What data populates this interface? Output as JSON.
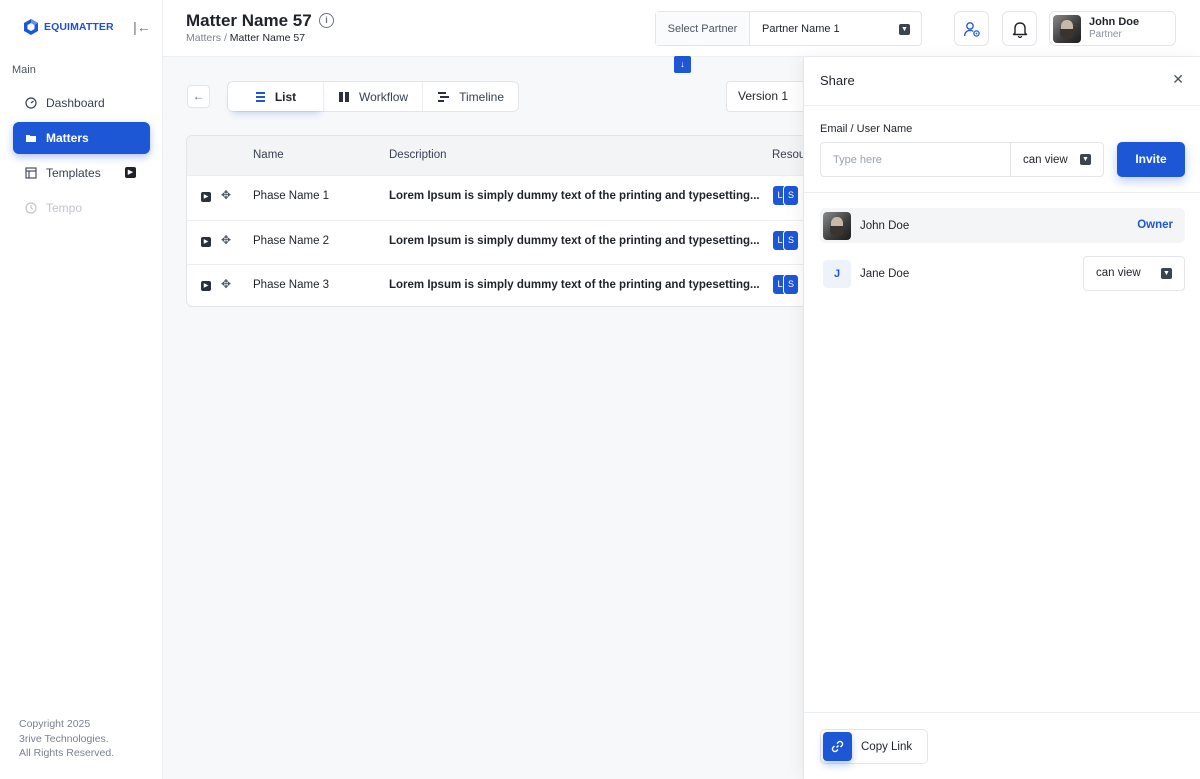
{
  "app": {
    "logo_text": "EQUIMATTER"
  },
  "sidebar": {
    "section_label": "Main",
    "items": [
      {
        "label": "Dashboard",
        "icon": "gauge-icon",
        "state": "normal"
      },
      {
        "label": "Matters",
        "icon": "folder-icon",
        "state": "active"
      },
      {
        "label": "Templates",
        "icon": "template-icon",
        "state": "normal"
      },
      {
        "label": "Tempo",
        "icon": "clock-icon",
        "state": "disabled"
      }
    ],
    "copyright": [
      "Copyright 2025",
      "3rive Technologies.",
      "All Rights Reserved."
    ]
  },
  "header": {
    "title": "Matter Name 57",
    "breadcrumb": {
      "parent": "Matters",
      "separator": "/",
      "current": "Matter Name 57"
    },
    "partner_select": {
      "label": "Select Partner",
      "value": "Partner Name 1"
    },
    "user": {
      "name": "John Doe",
      "role": "Partner"
    }
  },
  "toolbar": {
    "tabs": [
      {
        "label": "List",
        "icon": "list-icon",
        "active": true
      },
      {
        "label": "Workflow",
        "icon": "columns-icon",
        "active": false
      },
      {
        "label": "Timeline",
        "icon": "timeline-icon",
        "active": false
      }
    ],
    "version": "Version 1"
  },
  "table": {
    "columns": [
      "Name",
      "Description",
      "Resou"
    ],
    "rows": [
      {
        "name": "Phase Name 1",
        "description": "Lorem Ipsum is simply dummy text of the printing and typesetting...",
        "badges": [
          "L",
          "S"
        ]
      },
      {
        "name": "Phase Name 2",
        "description": "Lorem Ipsum is simply dummy text of the printing and typesetting...",
        "badges": [
          "L",
          "S"
        ]
      },
      {
        "name": "Phase Name 3",
        "description": "Lorem Ipsum is simply dummy text of the printing and typesetting...",
        "badges": [
          "L",
          "S"
        ]
      }
    ]
  },
  "share": {
    "title": "Share",
    "email_label": "Email / User Name",
    "input_placeholder": "Type here",
    "permission": "can view",
    "invite_label": "Invite",
    "members": [
      {
        "name": "John Doe",
        "role": "Owner"
      },
      {
        "initial": "J",
        "name": "Jane Doe",
        "permission": "can view"
      }
    ],
    "copy_link_label": "Copy Link"
  },
  "colors": {
    "primary": "#1d57d6",
    "text": "#1f2329",
    "muted": "#7b8190"
  }
}
